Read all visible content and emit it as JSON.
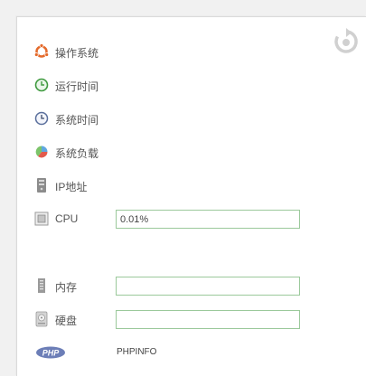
{
  "rows": [
    {
      "label": "操作系统",
      "icon": "ubuntu-icon"
    },
    {
      "label": "运行时间",
      "icon": "green-clock-icon"
    },
    {
      "label": "系统时间",
      "icon": "clock-icon"
    },
    {
      "label": "系统负载",
      "icon": "pie-chart-icon"
    },
    {
      "label": "IP地址",
      "icon": "server-icon"
    },
    {
      "label": "CPU",
      "icon": "cpu-icon",
      "value": "0.01%"
    },
    {
      "label": "内存",
      "icon": "memory-icon",
      "value": ""
    },
    {
      "label": "硬盘",
      "icon": "disk-icon",
      "value": ""
    }
  ],
  "php": {
    "logo_text": "PHP",
    "link_label": "PHPINFO"
  },
  "refresh_icon": "refresh-icon"
}
